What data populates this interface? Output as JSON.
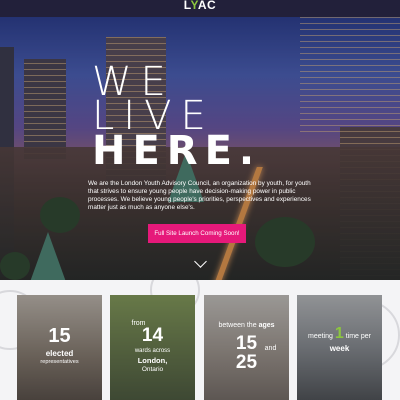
{
  "header": {
    "logo_prefix": "L",
    "logo_accent": "Y",
    "logo_suffix": "AC"
  },
  "hero": {
    "headline_1": "WE",
    "headline_2": "LIVE",
    "headline_3": "HERE.",
    "intro": "We are the London Youth Advisory Council, an organization by youth, for youth that strives to ensure young people have decision-making power in public processes. We believe young people's priorities, perspectives and experiences matter just as much as anyone else's.",
    "cta_label": "Full Site Launch Coming Soon!"
  },
  "stats": [
    {
      "number": "15",
      "line1": "elected",
      "line2": "representatives"
    },
    {
      "prefix": "from",
      "number": "14",
      "line1": "wards across",
      "line2": "London,",
      "line3": "Ontario"
    },
    {
      "prefix": "between the",
      "prefix_bold": "ages",
      "number_a": "15",
      "joiner": "and",
      "number_b": "25"
    },
    {
      "prefix": "meeting",
      "number": "1",
      "suffix": "time per",
      "line2": "week"
    }
  ],
  "colors": {
    "accent_green": "#8cc63f",
    "accent_pink": "#e6197a",
    "header_bg": "#22203a"
  }
}
